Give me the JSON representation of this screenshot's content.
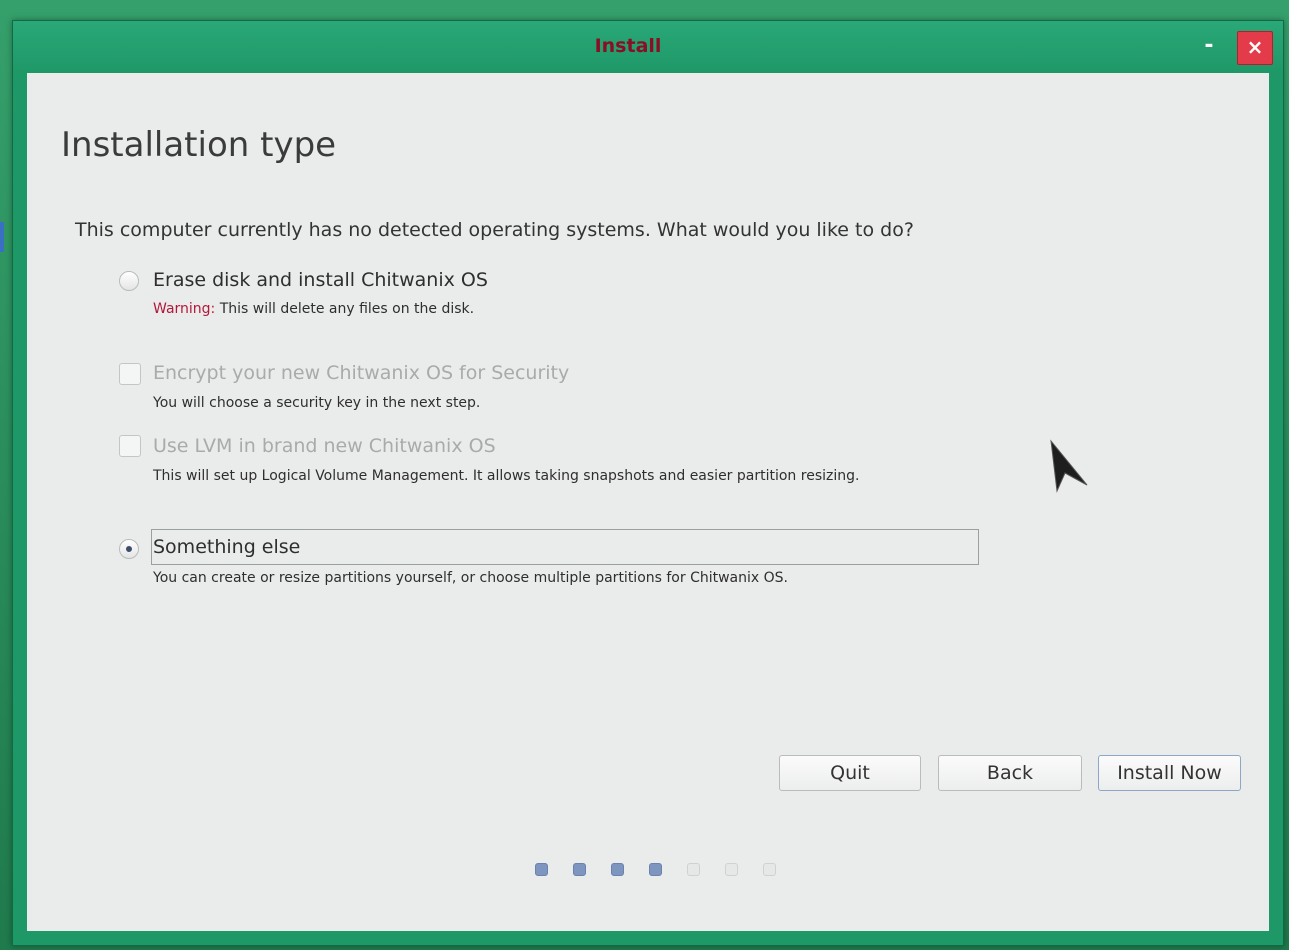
{
  "window": {
    "title": "Install",
    "minimize_glyph": "-",
    "close_glyph": "×"
  },
  "page": {
    "title": "Installation type",
    "question": "This computer currently has no detected operating systems. What would you like to do?"
  },
  "options": [
    {
      "kind": "radio",
      "label": "Erase disk and install Chitwanix OS",
      "checked": false,
      "enabled": true,
      "warning_label": "Warning:",
      "description": " This will delete any files on the disk."
    },
    {
      "kind": "checkbox",
      "label": "Encrypt your new Chitwanix OS for Security",
      "checked": false,
      "enabled": false,
      "description": "You will choose a security key in the next step."
    },
    {
      "kind": "checkbox",
      "label": "Use LVM in brand new Chitwanix OS",
      "checked": false,
      "enabled": false,
      "description": "This will set up Logical Volume Management. It allows taking snapshots and easier partition resizing."
    },
    {
      "kind": "radio",
      "label": "Something else",
      "checked": true,
      "enabled": true,
      "description": "You can create or resize partitions yourself, or choose multiple partitions for Chitwanix OS."
    }
  ],
  "buttons": {
    "quit": "Quit",
    "back": "Back",
    "install_now": "Install Now"
  },
  "progress": {
    "total_steps": 7,
    "completed_steps": 4
  },
  "colors": {
    "titlebar": "#1f9868",
    "close": "#e33b4a",
    "warning": "#b3183a",
    "progress_filled": "#7d95bf"
  }
}
